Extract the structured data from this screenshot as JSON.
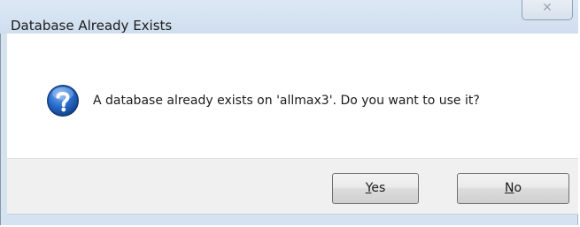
{
  "dialog": {
    "title": "Database Already Exists",
    "close_glyph": "✕",
    "message": "A database already exists on 'allmax3'.  Do you want to use it?",
    "icon": "question-icon"
  },
  "buttons": {
    "yes": {
      "mnemonic": "Y",
      "rest": "es"
    },
    "no": {
      "mnemonic": "N",
      "rest": "o"
    }
  },
  "colors": {
    "titlebar": "#d5e2f0",
    "icon_blue": "#1f5fb8",
    "footer": "#f0f0f0"
  }
}
